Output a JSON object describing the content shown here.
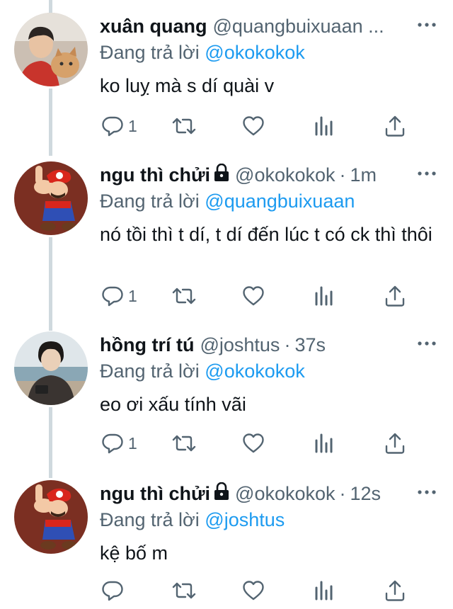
{
  "tweets": [
    {
      "name": "xuân quang",
      "handle": "@quangbuixuaan ...",
      "protected": false,
      "time": "",
      "reply_label": "Đang trả lời",
      "reply_to": "@okokokok",
      "text": "ko luỵ mà s dí quài v",
      "reply_count": "1"
    },
    {
      "name": "ngu thì chửi",
      "handle": "@okokokok",
      "protected": true,
      "time": "1m",
      "reply_label": "Đang trả lời",
      "reply_to": "@quangbuixuaan",
      "text": "nó tồi thì t dí, t dí đến lúc t có ck thì thôi",
      "reply_count": "1"
    },
    {
      "name": "hồng trí tú",
      "handle": "@joshtus",
      "protected": false,
      "time": "37s",
      "reply_label": "Đang trả lời",
      "reply_to": "@okokokok",
      "text": "eo ơi xấu tính vãi",
      "reply_count": "1"
    },
    {
      "name": "ngu thì chửi",
      "handle": "@okokokok",
      "protected": true,
      "time": "12s",
      "reply_label": "Đang trả lời",
      "reply_to": "@joshtus",
      "text": "kệ bố m",
      "reply_count": ""
    }
  ],
  "separator": "·",
  "colors": {
    "accent": "#1d9bf0",
    "secondary": "#536471",
    "thread_line": "#cfd9de"
  },
  "icons": [
    "reply-icon",
    "retweet-icon",
    "like-icon",
    "views-icon",
    "share-icon",
    "more-icon",
    "lock-icon"
  ]
}
